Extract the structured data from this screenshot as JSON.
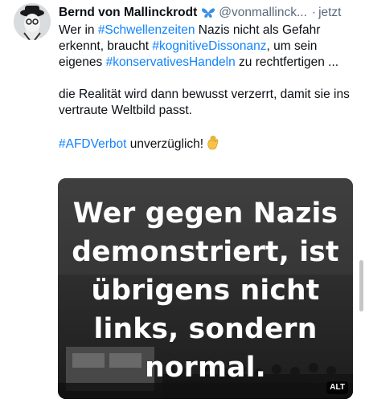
{
  "post": {
    "author_name": "Bernd von Mallinckrodt",
    "handle": "@vonmallinck...",
    "separator": "·",
    "time": "jetzt",
    "text": {
      "line1_pre": "Wer in ",
      "tag1": "#Schwellenzeiten",
      "line1_post": " Nazis nicht als Gefahr erkennt, braucht ",
      "tag2": "#kognitiveDissonanz",
      "line2_post": ", um sein eigenes ",
      "tag3": "#konservativesHandeln",
      "line3_post": " zu rechtfertigen ...",
      "paragraph2": "die Realität wird dann bewusst verzerrt, damit sie ins vertraute Weltbild passt.",
      "tag4": "#AFDVerbot",
      "paragraph3_post": " unverzüglich!"
    },
    "media": {
      "overlay_text": [
        "Wer gegen Nazis",
        "demonstriert, ist",
        "übrigens nicht",
        "links, sondern",
        "normal."
      ],
      "alt_label": "ALT"
    }
  },
  "icons": {
    "verified": "butterfly-icon",
    "emoji": "raised-hand-icon"
  },
  "colors": {
    "hashtag": "#1083fe",
    "butterfly": "#3a8fe8",
    "meta": "#5b6b7b"
  }
}
